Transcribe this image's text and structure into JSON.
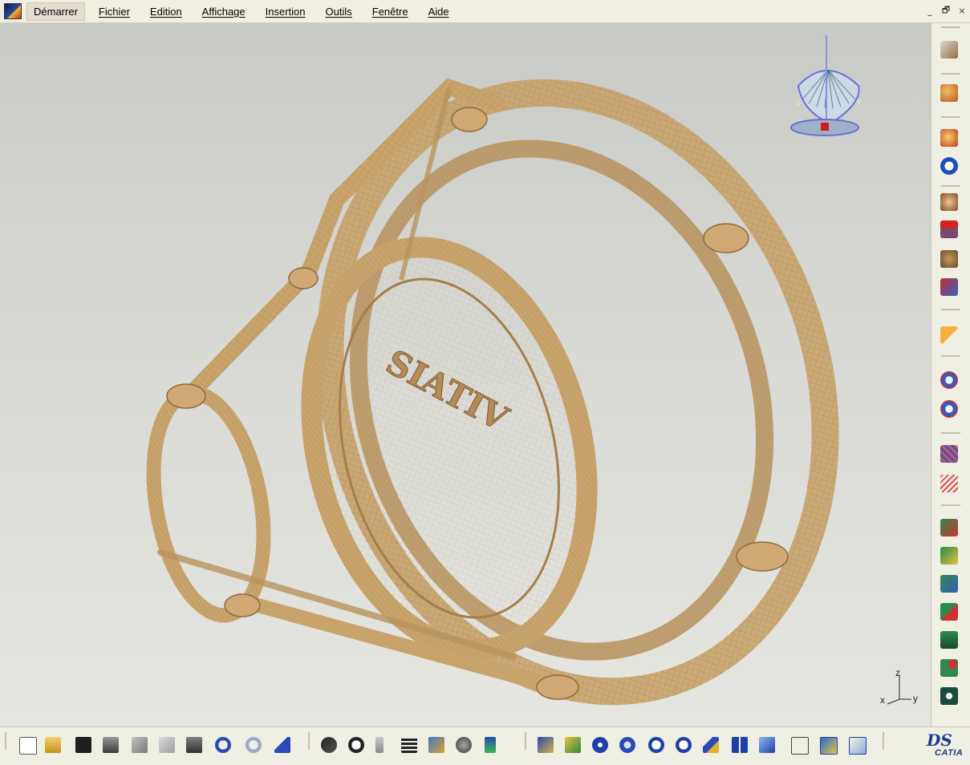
{
  "menu": {
    "items": [
      "Démarrer",
      "Fichier",
      "Edition",
      "Affichage",
      "Insertion",
      "Outils",
      "Fenêtre",
      "Aide"
    ],
    "window_controls": [
      "_",
      "🗗",
      "×"
    ]
  },
  "viewport": {
    "model_engraving": "SIATIV",
    "model_color": "#c8a36c",
    "compass_labels": {
      "z": "z",
      "x": "x",
      "y": "y"
    },
    "axis_triad": {
      "z": "z",
      "x": "x",
      "y": "y"
    }
  },
  "right_toolbar": {
    "icons": [
      "sketch-icon",
      "analysis-icon",
      "query-icon",
      "info-icon",
      "view-icon",
      "xml-icon",
      "tools-icon",
      "measure-icon",
      "select-cursor-icon",
      "surface-a-icon",
      "surface-b-icon",
      "mesh-a-icon",
      "mesh-b-icon",
      "patch-a-icon",
      "patch-b-icon",
      "patch-c-icon",
      "patch-d-icon",
      "patch-e-icon",
      "patch-f-icon",
      "patch-g-icon"
    ]
  },
  "bottom_toolbar": {
    "icons": [
      "new-file-icon",
      "open-file-icon",
      "save-icon",
      "print-icon",
      "cut-icon",
      "copy-icon",
      "paste-icon",
      "undo-icon",
      "redo-icon",
      "whats-this-icon",
      "formula-icon",
      "comment-icon",
      "knowledge-icon",
      "table-icon",
      "tree-icon",
      "catalog-icon",
      "display-list-icon",
      "fly-icon",
      "fit-all-icon",
      "pan-icon",
      "rotate-icon",
      "zoom-in-icon",
      "zoom-out-icon",
      "normal-view-icon",
      "multi-view-icon",
      "iso-view-icon",
      "render-style-icon",
      "hide-show-icon",
      "swap-visible-icon"
    ],
    "brand": {
      "ds": "DS",
      "catia": "CATIA"
    }
  }
}
